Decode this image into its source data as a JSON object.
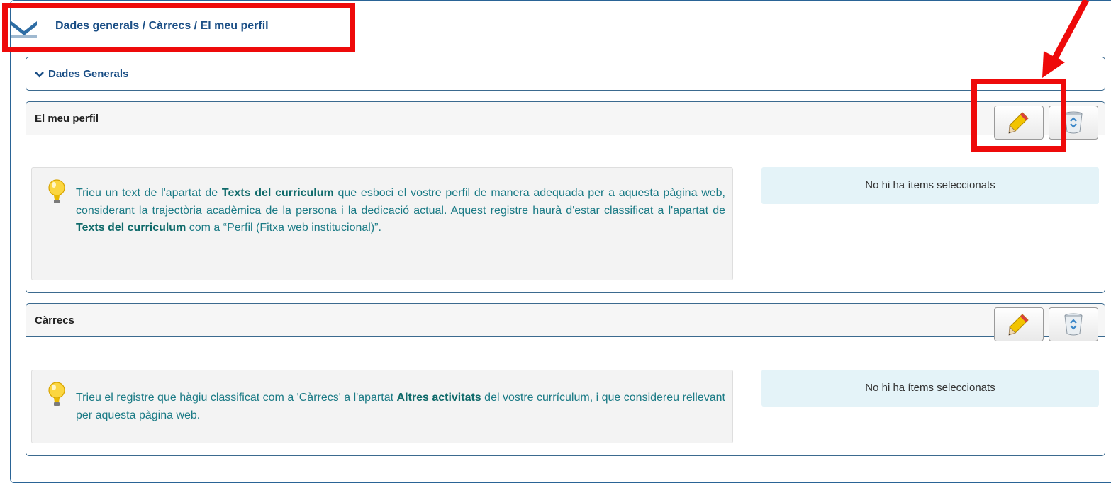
{
  "breadcrumb": "Dades generals / Càrrecs / El meu perfil",
  "general_panel": {
    "title": "Dades Generals"
  },
  "profile_panel": {
    "title": "El meu perfil",
    "tip": {
      "part1": "Trieu un text de l'apartat de ",
      "bold1": "Texts del curriculum",
      "part2": " que esboci el vostre perfil de manera adequada per a aquesta pàgina web, considerant la trajectòria acadèmica de la persona i la dedicació actual. Aquest registre haurà d'estar classificat a l'apartat de ",
      "bold2": "Texts del curriculum",
      "part3": " com a “Perfil (Fitxa web institucional)”."
    },
    "empty_text": "No hi ha ítems seleccionats"
  },
  "carrecs_panel": {
    "title": "Càrrecs",
    "tip": {
      "part1": "Trieu el registre que hàgiu classificat com a 'Càrrecs' a l'apartat ",
      "bold1": "Altres activitats",
      "part2": " del vostre currículum, i que considereu rellevant per aquesta pàgina web."
    },
    "empty_text": "No hi ha ítems seleccionats"
  },
  "icons": {
    "edit": "pencil-icon",
    "delete": "recycle-bin-icon",
    "tip": "lightbulb-icon",
    "collapse": "chevron-down-icon"
  },
  "colors": {
    "link_blue": "#1b4f86",
    "teal_text": "#1a7a85",
    "annotation_red": "#ee0a0a",
    "empty_bg": "#e4f3f8"
  }
}
